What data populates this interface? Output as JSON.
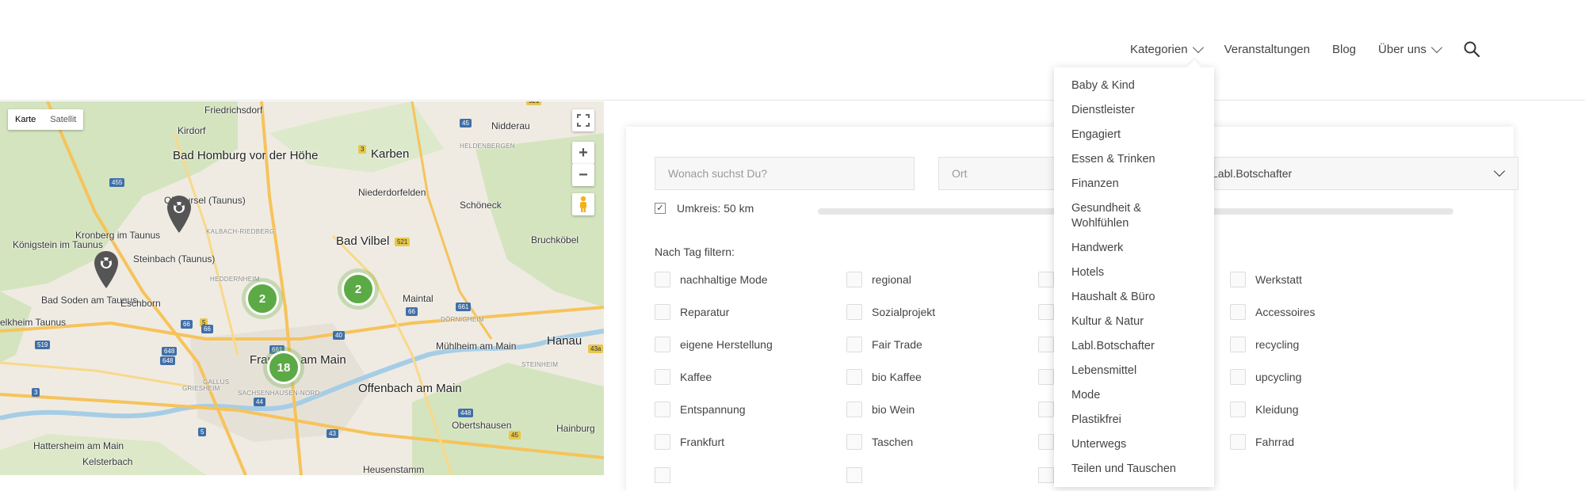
{
  "nav": {
    "items": [
      {
        "label": "Kategorien",
        "has_dropdown": true
      },
      {
        "label": "Veranstaltungen",
        "has_dropdown": false
      },
      {
        "label": "Blog",
        "has_dropdown": false
      },
      {
        "label": "Über uns",
        "has_dropdown": true
      }
    ],
    "search_icon": "search-icon"
  },
  "dropdown": {
    "items": [
      "Baby & Kind",
      "Dienstleister",
      "Engagiert",
      "Essen & Trinken",
      "Finanzen",
      "Gesundheit & Wohlfühlen",
      "Handwerk",
      "Hotels",
      "Haushalt & Büro",
      "Kultur & Natur",
      "Labl.Botschafter",
      "Lebensmittel",
      "Mode",
      "Plastikfrei",
      "Unterwegs",
      "Teilen und Tauschen"
    ]
  },
  "map": {
    "type_buttons": [
      "Karte",
      "Satellit"
    ],
    "active_type": "Karte",
    "zoom_in": "+",
    "zoom_out": "−",
    "labels": [
      "Friedrichsdorf",
      "Kirdorf",
      "Bad Homburg vor der Höhe",
      "Oberursel (Taunus)",
      "Karben",
      "Nidderau",
      "Niederdorfelden",
      "Schöneck",
      "Bad Vilbel",
      "Bruchköbel",
      "Königstein im Taunus",
      "Kronberg im Taunus",
      "Steinbach (Taunus)",
      "Bad Soden am Taunus",
      "Eschborn",
      "elkheim Taunus",
      "Maintal",
      "Hanau",
      "Mühlheim am Main",
      "Offenbach am Main",
      "Frankfurt am Main",
      "Hattersheim am Main",
      "Kelsterbach",
      "Obertshausen",
      "Hainburg",
      "Heusenstamm",
      "HELDENBERGEN",
      "KALBACH-RIEDBERG",
      "HEDDERNHEIM",
      "DÖRNIGHEIM",
      "STEINHEIM",
      "GRIESHEIM",
      "GALLUS",
      "SACHSENHAUSEN-NORD"
    ],
    "road_numbers": [
      "521",
      "45",
      "455",
      "3",
      "521",
      "661",
      "5",
      "66",
      "648",
      "66",
      "661",
      "519",
      "40",
      "648",
      "66",
      "44",
      "3",
      "448",
      "45",
      "43a",
      "5",
      "43"
    ],
    "clusters": [
      {
        "count": "2"
      },
      {
        "count": "2"
      },
      {
        "count": "18"
      }
    ],
    "colors": {
      "cluster": "#5caa45",
      "road": "#f6c35b",
      "water": "#a6cde6",
      "forest": "#c8dfb0"
    }
  },
  "search": {
    "what_placeholder": "Wonach suchst Du?",
    "where_placeholder": "Ort",
    "category_value": "Labl.Botschafter",
    "radius_label": "Umkreis: 50 km",
    "radius_checked": true
  },
  "filter": {
    "title": "Nach Tag filtern:",
    "columns": [
      [
        "nachhaltige Mode",
        "Reparatur",
        "eigene Herstellung",
        "Kaffee",
        "Entspannung",
        "Frankfurt"
      ],
      [
        "regional",
        "Sozialprojekt",
        "Fair Trade",
        "bio Kaffee",
        "bio Wein",
        "Taschen"
      ],
      [
        "",
        "",
        "",
        "",
        "",
        ""
      ],
      [
        "Werkstatt",
        "Accessoires",
        "recycling",
        "upcycling",
        "Kleidung",
        "Fahrrad"
      ]
    ]
  }
}
